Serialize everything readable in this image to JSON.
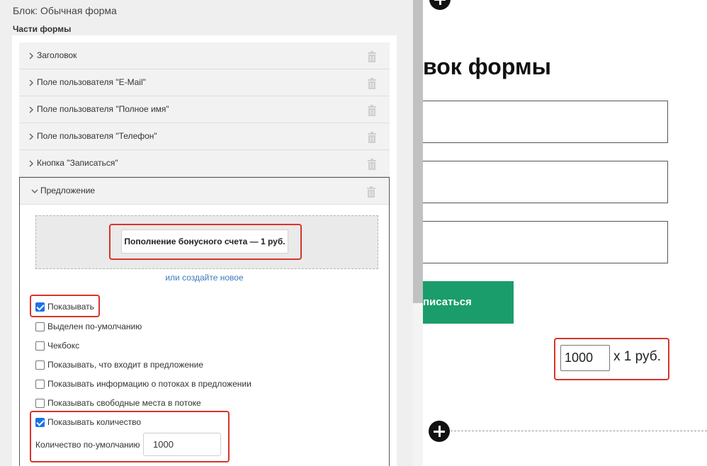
{
  "left_panel": {
    "title": "Блок: Обычная форма",
    "parts_title": "Части формы",
    "parts": [
      {
        "label": "Заголовок"
      },
      {
        "label": "Поле пользователя \"E-Mail\""
      },
      {
        "label": "Поле пользователя \"Полное имя\""
      },
      {
        "label": "Поле пользователя \"Телефон\""
      },
      {
        "label": "Кнопка \"Записаться\""
      }
    ],
    "offer": {
      "label": "Предложение",
      "chip": "Пополнение бонусного счета — 1 руб.",
      "create_link": "или создайте новое",
      "options": [
        {
          "label": "Показывать",
          "checked": true
        },
        {
          "label": "Выделен по-умолчанию",
          "checked": false
        },
        {
          "label": "Чекбокс",
          "checked": false
        },
        {
          "label": "Показывать, что входит в предложение",
          "checked": false
        },
        {
          "label": "Показывать информацию о потоках в предложении",
          "checked": false
        },
        {
          "label": "Показывать свободные места в потоке",
          "checked": false
        },
        {
          "label": "Показывать количество",
          "checked": true
        }
      ],
      "qty_label": "Количество по-умолчанию",
      "qty_value": "1000"
    }
  },
  "preview": {
    "heading": "вок формы",
    "button_label": "писаться",
    "qty_value": "1000",
    "price_text": "x 1 руб."
  },
  "colors": {
    "accent_button": "#1a9d6a",
    "highlight": "#d9342b",
    "checkbox": "#1a73e8",
    "link": "#3b7abf"
  }
}
